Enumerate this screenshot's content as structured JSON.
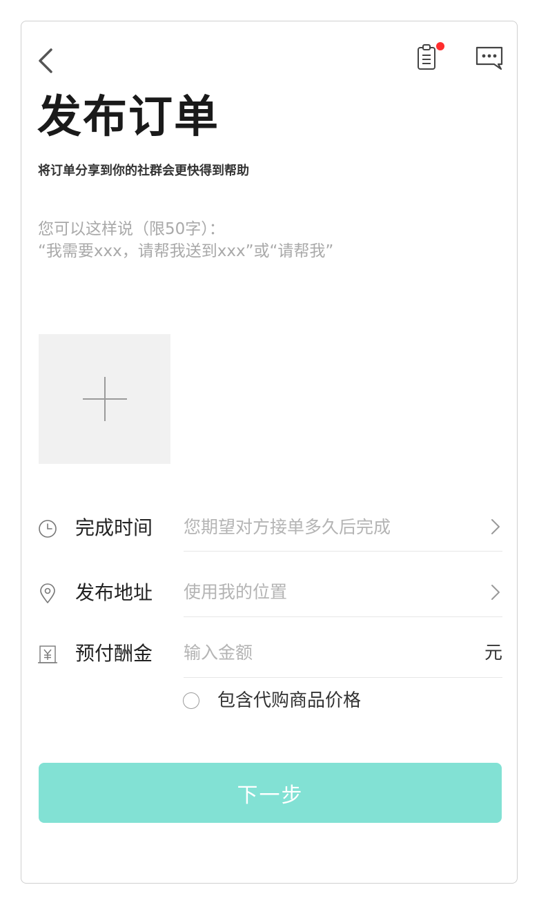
{
  "header": {
    "back_icon": "chevron-left-icon",
    "orders_icon": "clipboard-icon",
    "messages_icon": "chat-bubble-icon",
    "notification_dot_color": "#ff2d2d"
  },
  "page": {
    "title": "发布订单",
    "subtitle": "将订单分享到你的社群会更快得到帮助"
  },
  "description": {
    "hint_line1": "您可以这样说（限50字）：",
    "hint_line2": "“我需要xxx，请帮我送到xxx”或“请帮我”"
  },
  "upload": {
    "icon": "plus-icon"
  },
  "form": {
    "time": {
      "icon": "clock-icon",
      "label": "完成时间",
      "placeholder": "您期望对方接单多久后完成"
    },
    "address": {
      "icon": "location-pin-icon",
      "label": "发布地址",
      "placeholder": "使用我的位置"
    },
    "reward": {
      "icon": "yen-icon",
      "label": "预付酬金",
      "placeholder": "输入金额",
      "unit": "元"
    },
    "include_goods_price": {
      "label": "包含代购商品价格",
      "checked": false
    }
  },
  "submit": {
    "label": "下一步",
    "color": "#82e1d4"
  }
}
